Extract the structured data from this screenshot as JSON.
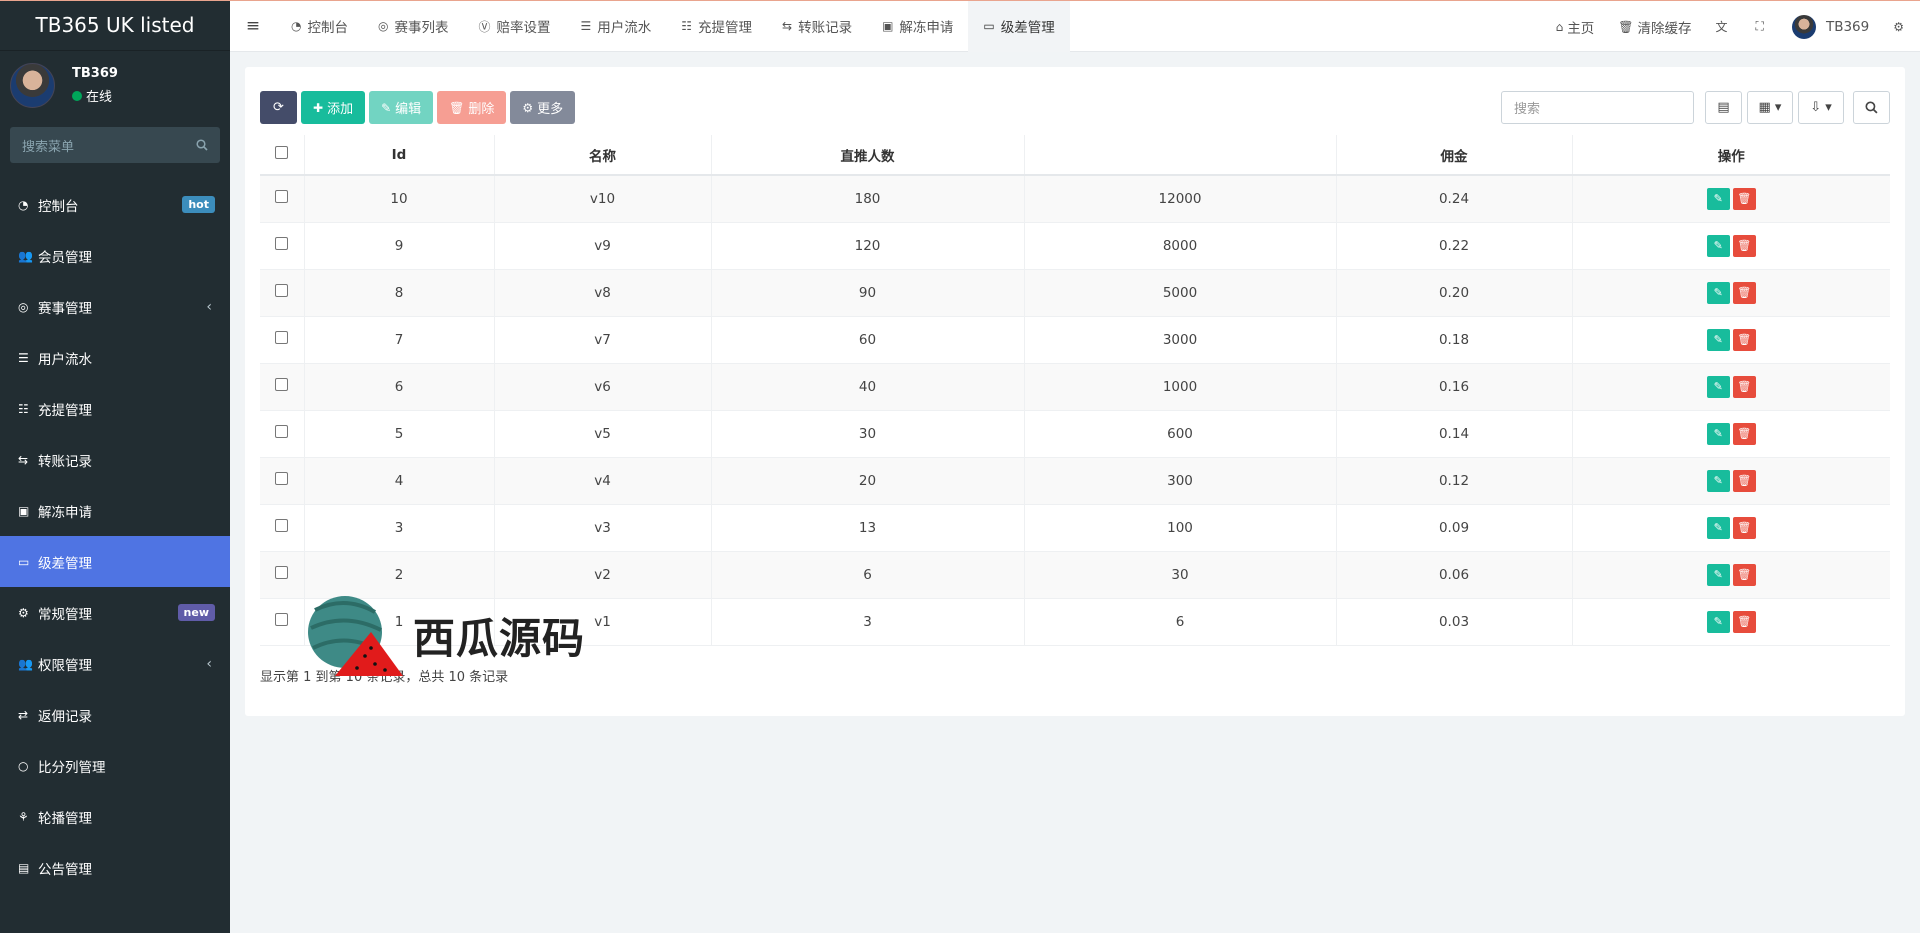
{
  "app": {
    "title": "TB365 UK listed"
  },
  "user": {
    "name": "TB369",
    "status": "在线"
  },
  "sidebar": {
    "search_placeholder": "搜索菜单",
    "items": [
      {
        "label": "控制台",
        "icon": "dashboard-icon",
        "badge": "hot"
      },
      {
        "label": "会员管理",
        "icon": "users-icon"
      },
      {
        "label": "赛事管理",
        "icon": "globe-icon",
        "caret": "‹"
      },
      {
        "label": "用户流水",
        "icon": "list-icon"
      },
      {
        "label": "充提管理",
        "icon": "indent-icon"
      },
      {
        "label": "转账记录",
        "icon": "transfer-icon"
      },
      {
        "label": "解冻申请",
        "icon": "picture-icon"
      },
      {
        "label": "级差管理",
        "icon": "window-icon",
        "active": true
      },
      {
        "label": "常规管理",
        "icon": "cogs-icon",
        "badge": "new"
      },
      {
        "label": "权限管理",
        "icon": "group-icon",
        "caret": "‹"
      },
      {
        "label": "返佣记录",
        "icon": "rebate-icon"
      },
      {
        "label": "比分列管理",
        "icon": "circle-icon"
      },
      {
        "label": "轮播管理",
        "icon": "carousel-icon"
      },
      {
        "label": "公告管理",
        "icon": "notice-icon"
      }
    ]
  },
  "navbar": {
    "tabs": [
      "控制台",
      "赛事列表",
      "赔率设置",
      "用户流水",
      "充提管理",
      "转账记录",
      "解冻申请",
      "级差管理"
    ],
    "home": "主页",
    "clear_cache": "清除缓存",
    "user": "TB369"
  },
  "toolbar": {
    "add": "添加",
    "edit": "编辑",
    "delete": "删除",
    "more": "更多",
    "search_placeholder": "搜索"
  },
  "table": {
    "headers": [
      "Id",
      "名称",
      "直推人数",
      "",
      "佣金",
      "操作"
    ],
    "rows": [
      {
        "id": "10",
        "name": "v10",
        "direct": "180",
        "amount": "12000",
        "commission": "0.24"
      },
      {
        "id": "9",
        "name": "v9",
        "direct": "120",
        "amount": "8000",
        "commission": "0.22"
      },
      {
        "id": "8",
        "name": "v8",
        "direct": "90",
        "amount": "5000",
        "commission": "0.20"
      },
      {
        "id": "7",
        "name": "v7",
        "direct": "60",
        "amount": "3000",
        "commission": "0.18"
      },
      {
        "id": "6",
        "name": "v6",
        "direct": "40",
        "amount": "1000",
        "commission": "0.16"
      },
      {
        "id": "5",
        "name": "v5",
        "direct": "30",
        "amount": "600",
        "commission": "0.14"
      },
      {
        "id": "4",
        "name": "v4",
        "direct": "20",
        "amount": "300",
        "commission": "0.12"
      },
      {
        "id": "3",
        "name": "v3",
        "direct": "13",
        "amount": "100",
        "commission": "0.09"
      },
      {
        "id": "2",
        "name": "v2",
        "direct": "6",
        "amount": "30",
        "commission": "0.06"
      },
      {
        "id": "1",
        "name": "v1",
        "direct": "3",
        "amount": "6",
        "commission": "0.03"
      }
    ]
  },
  "pager": {
    "text": "显示第 1 到第 10 条记录，总共 10 条记录"
  },
  "watermark": {
    "text": "西瓜源码"
  }
}
